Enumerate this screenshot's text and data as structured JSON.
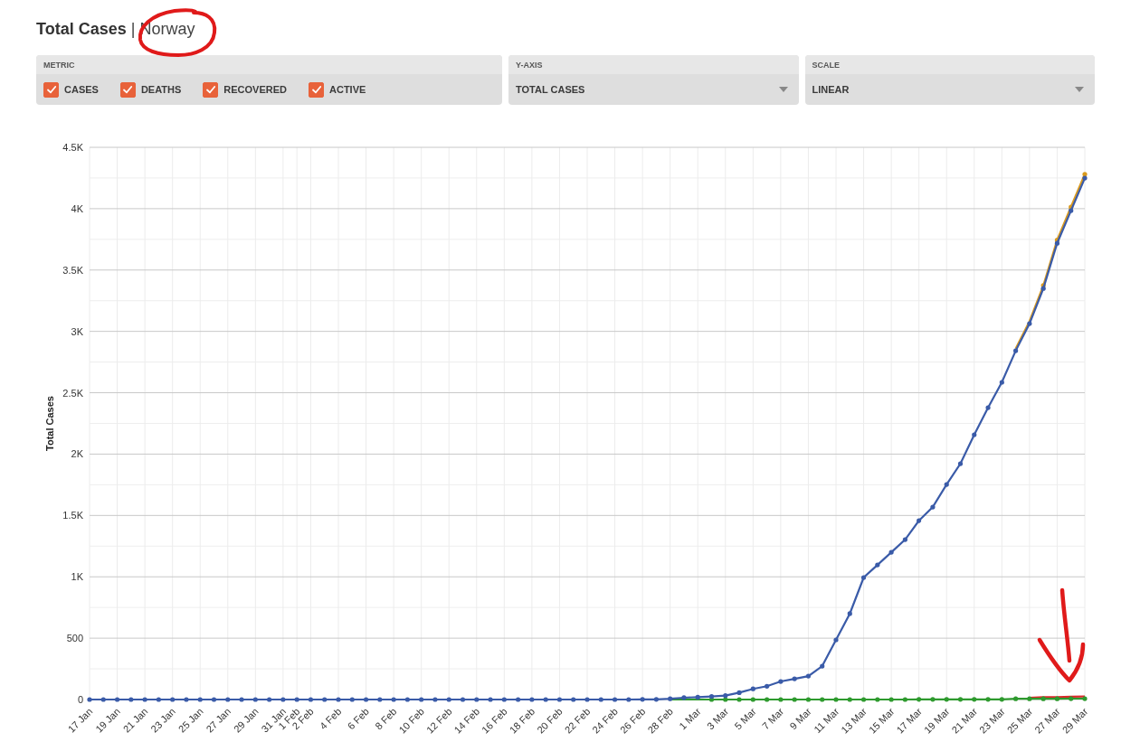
{
  "header": {
    "title": "Total Cases",
    "separator": "|",
    "country": "Norway"
  },
  "controls": {
    "metric": {
      "label": "METRIC",
      "options": [
        {
          "label": "CASES",
          "checked": true
        },
        {
          "label": "DEATHS",
          "checked": true
        },
        {
          "label": "RECOVERED",
          "checked": true
        },
        {
          "label": "ACTIVE",
          "checked": true
        }
      ]
    },
    "y_axis": {
      "label": "Y-AXIS",
      "value": "TOTAL CASES"
    },
    "scale": {
      "label": "SCALE",
      "value": "LINEAR"
    }
  },
  "chart_data": {
    "type": "line",
    "ylabel": "Total Cases",
    "grid": true,
    "categories": [
      "17 Jan",
      null,
      "19 Jan",
      null,
      "21 Jan",
      null,
      "23 Jan",
      null,
      "25 Jan",
      null,
      "27 Jan",
      null,
      "29 Jan",
      null,
      "31 Jan",
      "1 Feb",
      "2 Feb",
      null,
      "4 Feb",
      null,
      "6 Feb",
      null,
      "8 Feb",
      null,
      "10 Feb",
      null,
      "12 Feb",
      null,
      "14 Feb",
      null,
      "16 Feb",
      null,
      "18 Feb",
      null,
      "20 Feb",
      null,
      "22 Feb",
      null,
      "24 Feb",
      null,
      "26 Feb",
      null,
      "28 Feb",
      null,
      "1 Mar",
      null,
      "3 Mar",
      null,
      "5 Mar",
      null,
      "7 Mar",
      null,
      "9 Mar",
      null,
      "11 Mar",
      null,
      "13 Mar",
      null,
      "15 Mar",
      null,
      "17 Mar",
      null,
      "19 Mar",
      null,
      "21 Mar",
      null,
      "23 Mar",
      null,
      "25 Mar",
      null,
      "27 Mar",
      null,
      "29 Mar"
    ],
    "ylim": [
      0,
      4500
    ],
    "yticks": [
      {
        "value": 0,
        "label": "0"
      },
      {
        "value": 500,
        "label": "500"
      },
      {
        "value": 1000,
        "label": "1K"
      },
      {
        "value": 1500,
        "label": "1.5K"
      },
      {
        "value": 2000,
        "label": "2K"
      },
      {
        "value": 2500,
        "label": "2.5K"
      },
      {
        "value": 3000,
        "label": "3K"
      },
      {
        "value": 3500,
        "label": "3.5K"
      },
      {
        "value": 4000,
        "label": "4K"
      },
      {
        "value": 4500,
        "label": "4.5K"
      }
    ],
    "series": [
      {
        "color": "#d99a1e",
        "values": [
          null,
          null,
          null,
          null,
          null,
          null,
          null,
          null,
          null,
          null,
          null,
          null,
          null,
          null,
          null,
          null,
          null,
          null,
          null,
          null,
          null,
          null,
          null,
          null,
          null,
          null,
          null,
          null,
          null,
          null,
          null,
          null,
          null,
          null,
          null,
          null,
          null,
          null,
          null,
          null,
          null,
          null,
          null,
          null,
          null,
          null,
          null,
          null,
          null,
          null,
          null,
          null,
          null,
          null,
          null,
          null,
          null,
          null,
          null,
          null,
          null,
          null,
          null,
          null,
          null,
          null,
          null,
          2860,
          3083,
          3375,
          3744,
          4014,
          4281
        ]
      },
      {
        "color": "#d62a2a",
        "values": [
          null,
          null,
          null,
          null,
          null,
          null,
          null,
          null,
          null,
          null,
          null,
          null,
          null,
          null,
          null,
          null,
          null,
          null,
          null,
          null,
          null,
          null,
          null,
          null,
          null,
          null,
          null,
          null,
          null,
          null,
          null,
          null,
          null,
          null,
          null,
          null,
          null,
          null,
          null,
          null,
          null,
          null,
          null,
          null,
          null,
          null,
          null,
          null,
          null,
          null,
          null,
          null,
          null,
          null,
          null,
          null,
          null,
          null,
          null,
          null,
          null,
          null,
          null,
          null,
          null,
          null,
          null,
          null,
          14,
          19,
          20,
          23,
          25
        ]
      },
      {
        "color": "#2e9a2e",
        "values": [
          null,
          null,
          null,
          null,
          null,
          null,
          null,
          null,
          null,
          null,
          null,
          null,
          null,
          null,
          null,
          null,
          null,
          null,
          null,
          null,
          null,
          null,
          null,
          null,
          null,
          null,
          null,
          null,
          null,
          null,
          null,
          null,
          null,
          null,
          null,
          null,
          null,
          null,
          null,
          null,
          null,
          null,
          0,
          0,
          0,
          0,
          0,
          0,
          0,
          0,
          0,
          0,
          0,
          0,
          0,
          0,
          0,
          0,
          0,
          0,
          1,
          1,
          1,
          1,
          1,
          1,
          1,
          6,
          6,
          6,
          6,
          7,
          7
        ]
      },
      {
        "color": "#3a5ba8",
        "values": [
          0,
          0,
          0,
          0,
          0,
          0,
          0,
          0,
          0,
          0,
          0,
          0,
          0,
          0,
          0,
          0,
          0,
          0,
          0,
          0,
          0,
          0,
          0,
          0,
          0,
          0,
          0,
          0,
          0,
          0,
          0,
          0,
          0,
          0,
          0,
          0,
          0,
          0,
          0,
          0,
          1,
          1,
          6,
          15,
          19,
          25,
          32,
          56,
          87,
          108,
          147,
          169,
          191,
          272,
          486,
          700,
          994,
          1097,
          1200,
          1303,
          1458,
          1568,
          1752,
          1922,
          2158,
          2378,
          2585,
          2842,
          3063,
          3350,
          3718,
          3984,
          4249
        ]
      }
    ]
  }
}
